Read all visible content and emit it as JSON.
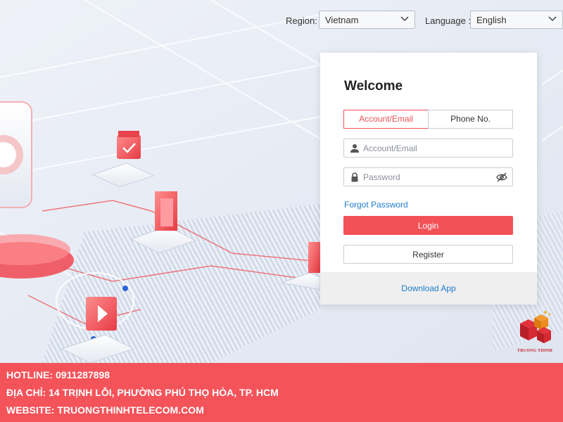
{
  "top_bar": {
    "region_label": "Region:",
    "region_value": "Vietnam",
    "language_label": "Language :",
    "language_value": "English"
  },
  "login": {
    "title": "Welcome",
    "tabs": [
      {
        "label": "Account/Email",
        "active": true
      },
      {
        "label": "Phone No.",
        "active": false
      }
    ],
    "account_placeholder": "Account/Email",
    "password_placeholder": "Password",
    "forgot_label": "Forgot Password",
    "login_label": "Login",
    "register_label": "Register",
    "download_label": "Download App"
  },
  "logo": {
    "text": "TRUONG THINH"
  },
  "footer": {
    "hotline": "HOTLINE: 0911287898",
    "address": "ĐỊA CHỈ: 14 TRỊNH LỖI, PHƯỜNG PHÚ THỌ HÒA, TP. HCM",
    "website": "WEBSITE: TRUONGTHINHTELECOM.COM"
  },
  "colors": {
    "accent": "#f25157",
    "link": "#1f7ccf",
    "footer_bg": "#f5535a"
  },
  "icons": [
    "chevron-down-icon",
    "user-icon",
    "lock-icon",
    "eye-off-icon"
  ]
}
